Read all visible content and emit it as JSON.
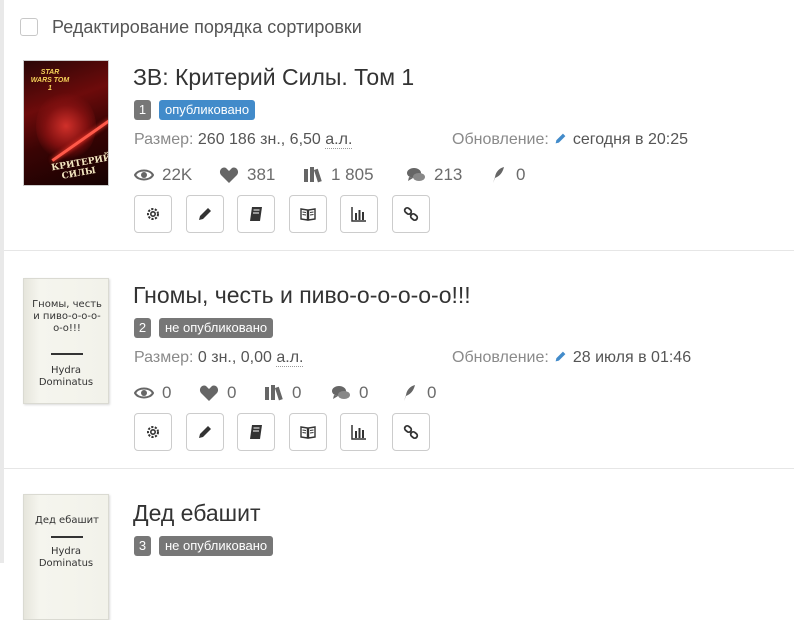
{
  "sort_toggle": {
    "label": "Редактирование порядка сортировки",
    "checked": false
  },
  "labels": {
    "size": "Размер:",
    "updated": "Обновление:"
  },
  "colors": {
    "published": "#428bca",
    "draft": "#777777",
    "icon": "#666666"
  },
  "action_icons": [
    "gear-icon",
    "pencil-icon",
    "book-icon",
    "open-book-icon",
    "bar-chart-icon",
    "link-icon"
  ],
  "books": [
    {
      "number": "1",
      "title": "ЗВ: Критерий Силы. Том 1",
      "status": "опубликовано",
      "status_type": "published",
      "size_text": "260 186 зн., 6,50",
      "size_unit": "а.л.",
      "updated": "сегодня в 20:25",
      "views": "22K",
      "likes": "381",
      "library": "1 805",
      "comments": "213",
      "awards": "0",
      "cover": {
        "type": "art",
        "top_text": "STAR WARS ТОМ 1",
        "bottom_text": "КРИТЕРИЙ СИЛЫ"
      }
    },
    {
      "number": "2",
      "title": "Гномы, честь и пиво-о-о-о-о-о!!!",
      "status": "не опубликовано",
      "status_type": "draft",
      "size_text": "0 зн., 0,00",
      "size_unit": "а.л.",
      "updated": "28 июля в 01:46",
      "views": "0",
      "likes": "0",
      "library": "0",
      "comments": "0",
      "awards": "0",
      "cover": {
        "type": "plain",
        "title": "Гномы, честь и пиво-о-о-о-о-о!!!",
        "author": "Hydra Dominatus"
      }
    },
    {
      "number": "3",
      "title": "Дед ебашит",
      "status": "не опубликовано",
      "status_type": "draft",
      "cover": {
        "type": "plain",
        "title": "Дед ебашит",
        "author": "Hydra Dominatus"
      }
    }
  ]
}
